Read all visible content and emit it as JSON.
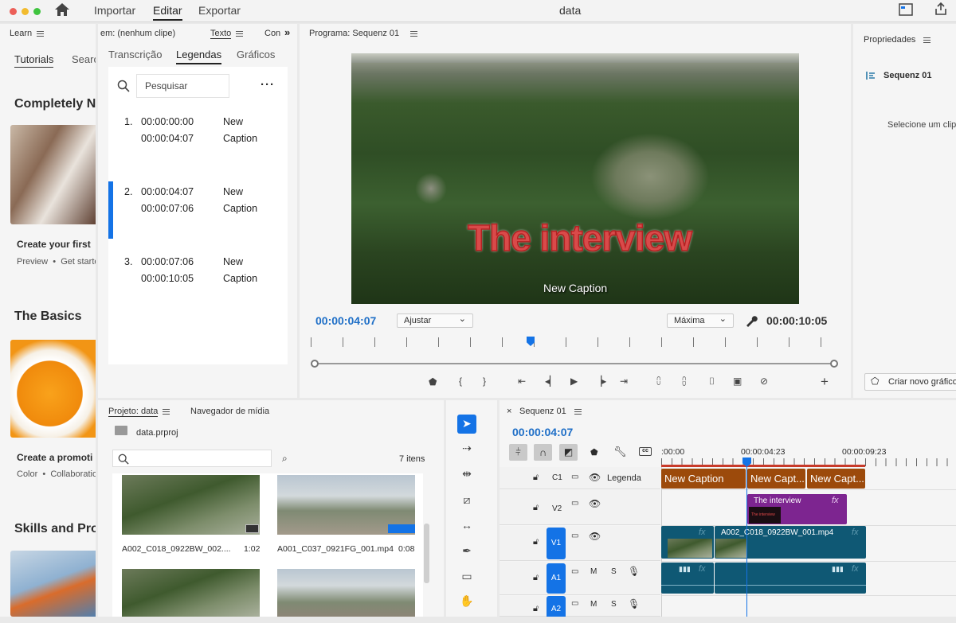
{
  "titlebar": {
    "home_label": "",
    "nav": [
      "Importar",
      "Editar",
      "Exportar"
    ],
    "title": "data"
  },
  "learn": {
    "panel_title": "Learn",
    "tabs": [
      "Tutorials",
      "Search"
    ],
    "sections": [
      {
        "heading": "Completely N",
        "card_title": "Create your first",
        "card_meta": "Preview  •  Get starte"
      },
      {
        "heading": "The Basics",
        "card_title": "Create a promoti",
        "card_meta": "Color  •  Collaboratio"
      },
      {
        "heading": "Skills and Pro"
      }
    ]
  },
  "text_panel": {
    "tab_prefix": "em: (nenhum clipe)",
    "tab_active": "Texto",
    "tab_more": "Con",
    "subtabs": [
      "Transcrição",
      "Legendas",
      "Gráficos"
    ],
    "search_placeholder": "Pesquisar",
    "captions": [
      {
        "num": "1.",
        "in": "00:00:00:00",
        "out": "00:00:04:07",
        "text1": "New",
        "text2": "Caption"
      },
      {
        "num": "2.",
        "in": "00:00:04:07",
        "out": "00:00:07:06",
        "text1": "New",
        "text2": "Caption"
      },
      {
        "num": "3.",
        "in": "00:00:07:06",
        "out": "00:00:10:05",
        "text1": "New",
        "text2": "Caption"
      }
    ]
  },
  "program": {
    "title": "Programa: Sequenz 01",
    "overlay_title": "The interview",
    "overlay_caption": "New Caption",
    "timecode": "00:00:04:07",
    "fit": "Ajustar",
    "quality": "Máxima",
    "duration": "00:00:10:05"
  },
  "properties": {
    "title": "Propriedades",
    "sequence": "Sequenz 01",
    "hint": "Selecione um clip",
    "new_graphic": "Criar novo gráfico"
  },
  "project": {
    "tab_active": "Projeto: data",
    "tab2": "Navegador de mídia",
    "file": "data.prproj",
    "count": "7 itens",
    "items": [
      {
        "name": "A002_C018_0922BW_002....",
        "dur": "1:02"
      },
      {
        "name": "A001_C037_0921FG_001.mp4",
        "dur": "0:08"
      }
    ]
  },
  "timeline": {
    "tab": "Sequenz 01",
    "timecode": "00:00:04:07",
    "ruler": [
      ":00:00",
      "00:00:04:23",
      "00:00:09:23"
    ],
    "tracks": {
      "c1": "C1",
      "c1_label": "Legenda",
      "v2": "V2",
      "v1": "V1",
      "a1": "A1",
      "a2": "A2",
      "m": "M",
      "s": "S"
    },
    "captions": [
      "New Caption",
      "New Capt...",
      "New Capt..."
    ],
    "graphic": "The interview",
    "graphic_small": "The interview",
    "video_clip": "A002_C018_0922BW_001.mp4",
    "fx": "fx"
  },
  "colors": {
    "accent": "#1473e6",
    "caption_clip": "#9c4a0b",
    "graphic_clip": "#7d2590",
    "video_clip": "#0f5874",
    "timecode": "#1f6fc7"
  }
}
